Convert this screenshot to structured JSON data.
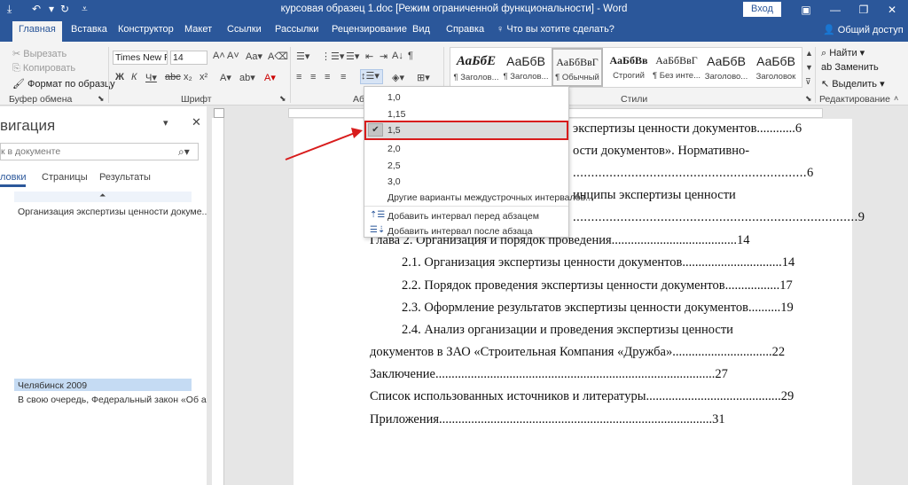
{
  "titlebar": {
    "title": "курсовая образец 1.doc [Режим ограниченной функциональности]  -  Word",
    "signin": "Вход"
  },
  "tabs": [
    {
      "label": "Главная",
      "active": true
    },
    {
      "label": "Вставка"
    },
    {
      "label": "Конструктор"
    },
    {
      "label": "Макет"
    },
    {
      "label": "Ссылки"
    },
    {
      "label": "Рассылки"
    },
    {
      "label": "Рецензирование"
    },
    {
      "label": "Вид"
    },
    {
      "label": "Справка"
    }
  ],
  "tellme": "Что вы хотите сделать?",
  "share": "Общий доступ",
  "clipboard": {
    "cut": "Вырезать",
    "copy": "Копировать",
    "format_painter": "Формат по образцу",
    "group_label": "Буфер обмена"
  },
  "font": {
    "name": "Times New R",
    "size": "14",
    "group_label": "Шрифт"
  },
  "paragraph": {
    "group_label": "Аб"
  },
  "styles": {
    "group_label": "Стили",
    "items": [
      {
        "sample": "АаБбЕ",
        "name": "¶ Заголов..."
      },
      {
        "sample": "АаБбВ",
        "name": "¶ Заголов..."
      },
      {
        "sample": "АаБбВвГ",
        "name": "¶ Обычный",
        "selected": true
      },
      {
        "sample": "АаБбВв",
        "name": "Строгий"
      },
      {
        "sample": "АаБбВвГ",
        "name": "¶ Без инте..."
      },
      {
        "sample": "АаБбВ",
        "name": "Заголово..."
      },
      {
        "sample": "АаБбВ",
        "name": "Заголовок"
      }
    ]
  },
  "editing": {
    "find": "Найти",
    "replace": "Заменить",
    "select": "Выделить",
    "group_label": "Редактирование"
  },
  "nav": {
    "title": "вигация",
    "search_placeholder": "к в документе",
    "tabs": [
      "ловки",
      "Страницы",
      "Результаты"
    ],
    "items": [
      "Организация экспертизы ценности докуме...",
      "Челябинск 2009",
      "В свою очередь, Федеральный закон «Об а..."
    ]
  },
  "line_spacing_menu": {
    "options": [
      "1,0",
      "1,15",
      "1,5",
      "2,0",
      "2,5",
      "3,0"
    ],
    "selected": "1,5",
    "more": "Другие варианты междустрочных интервалов...",
    "add_before": "Добавить интервал перед абзацем",
    "add_after": "Добавить интервал после абзаца"
  },
  "document": {
    "lines": [
      {
        "text": "экспертизы ценности документов............6"
      },
      {
        "text": "ости документов». Нормативно-"
      },
      {
        "text": "................................................................6"
      },
      {
        "text": "инципы экспертизы ценности"
      },
      {
        "text": "..............................................................................9"
      },
      {
        "text": "Глава 2. Организация и порядок проведения.......................................14"
      },
      {
        "text": "2.1. Организация экспертизы ценности документов...............................14"
      },
      {
        "text": "2.2. Порядок проведения экспертизы ценности документов.................17"
      },
      {
        "text": "2.3. Оформление результатов экспертизы ценности документов..........19"
      },
      {
        "text": "2.4.   Анализ   организации   и   проведения   экспертизы   ценности"
      },
      {
        "text": "документов в ЗАО «Строительная Компания «Дружба»...............................22"
      },
      {
        "text": "Заключение.......................................................................................27"
      },
      {
        "text": "Список использованных источников и литературы..........................................29"
      },
      {
        "text": "Приложения.....................................................................................31"
      }
    ]
  },
  "colors": {
    "brand": "#2b579a",
    "highlight_box": "#d81c1c"
  }
}
